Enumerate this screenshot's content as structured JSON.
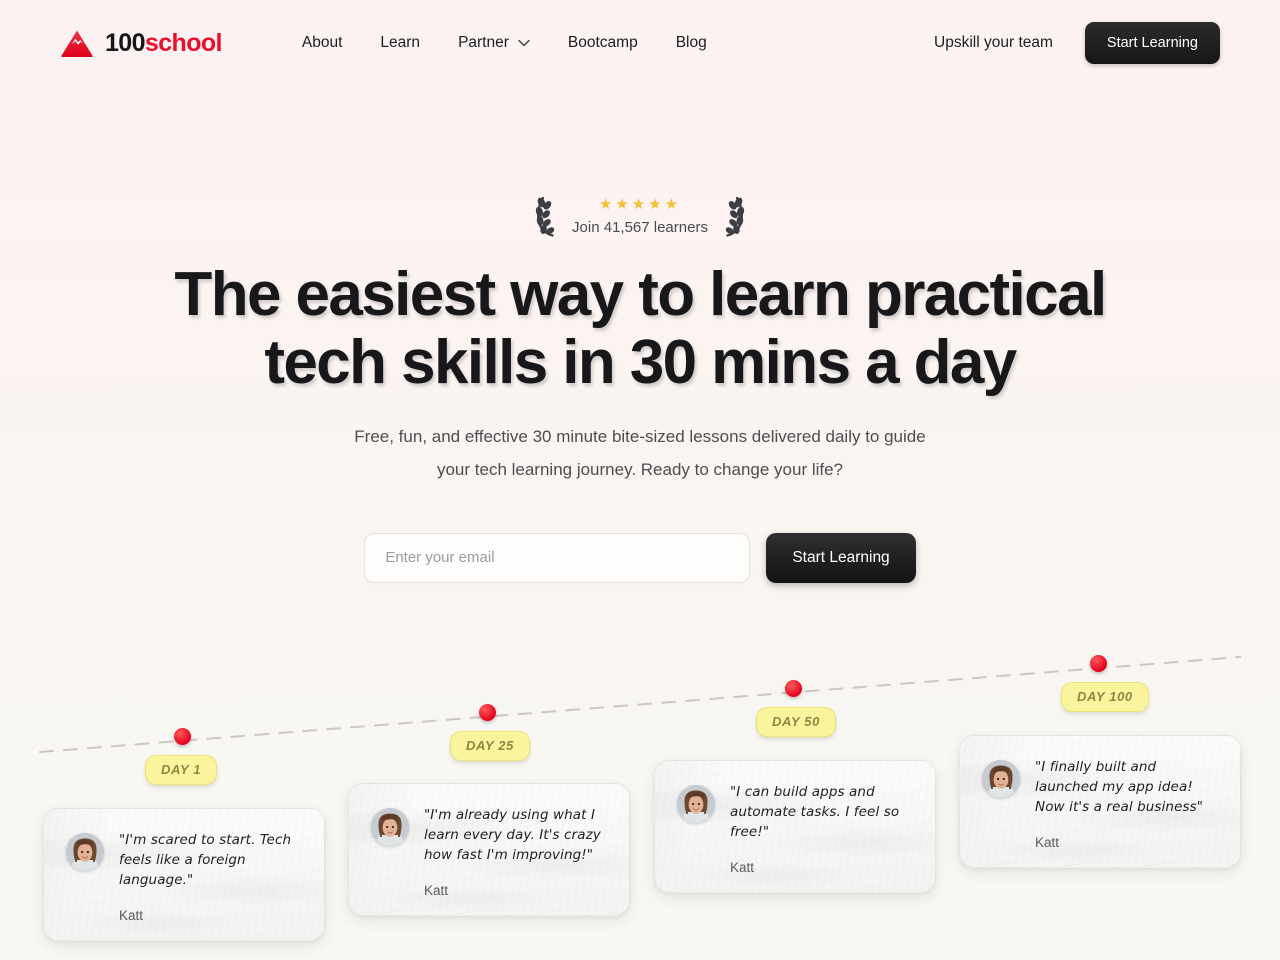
{
  "brand": {
    "logo_icon": "mountain-icon",
    "name_primary": "100",
    "name_secondary": "school"
  },
  "nav": {
    "items": [
      {
        "label": "About",
        "has_dropdown": false
      },
      {
        "label": "Learn",
        "has_dropdown": false
      },
      {
        "label": "Partner",
        "has_dropdown": true,
        "dropdown_icon": "chevron-down-icon"
      },
      {
        "label": "Bootcamp",
        "has_dropdown": false
      },
      {
        "label": "Blog",
        "has_dropdown": false
      }
    ],
    "upskill_label": "Upskill your team",
    "cta_label": "Start Learning"
  },
  "hero": {
    "stars": "★★★★★",
    "star_count": 5,
    "learners_text": "Join 41,567 learners",
    "laurel_icon": "laurel-branch-icon",
    "headline_line1": "The easiest way to learn practical",
    "headline_line2": "tech skills in 30 mins a day",
    "subhead": "Free, fun, and effective 30 minute bite-sized lessons delivered daily to guide your tech learning journey. Ready to change your life?",
    "email_placeholder": "Enter your email",
    "email_value": "",
    "submit_label": "Start Learning"
  },
  "timeline": {
    "milestones": [
      {
        "badge": "DAY 1",
        "quote": "\"I'm scared to start. Tech feels like a foreign language.\"",
        "name": "Katt",
        "avatar_icon": "user-avatar"
      },
      {
        "badge": "DAY 25",
        "quote": "\"I'm already using what I learn every day. It's crazy how fast I'm improving!\"",
        "name": "Katt",
        "avatar_icon": "user-avatar"
      },
      {
        "badge": "DAY 50",
        "quote": "\"I can build apps and automate tasks. I feel so free!\"",
        "name": "Katt",
        "avatar_icon": "user-avatar"
      },
      {
        "badge": "DAY 100",
        "quote": "\"I finally built and launched my app idea! Now it's a real business\"",
        "name": "Katt",
        "avatar_icon": "user-avatar"
      }
    ]
  },
  "colors": {
    "brand_red": "#e8112d",
    "dark_button": "#161618",
    "star_gold": "#f2c033",
    "badge_yellow": "#faf49c",
    "dot_red": "#e3001b",
    "bg_top": "#fdf2f2",
    "bg_bottom": "#f8f7f3"
  }
}
